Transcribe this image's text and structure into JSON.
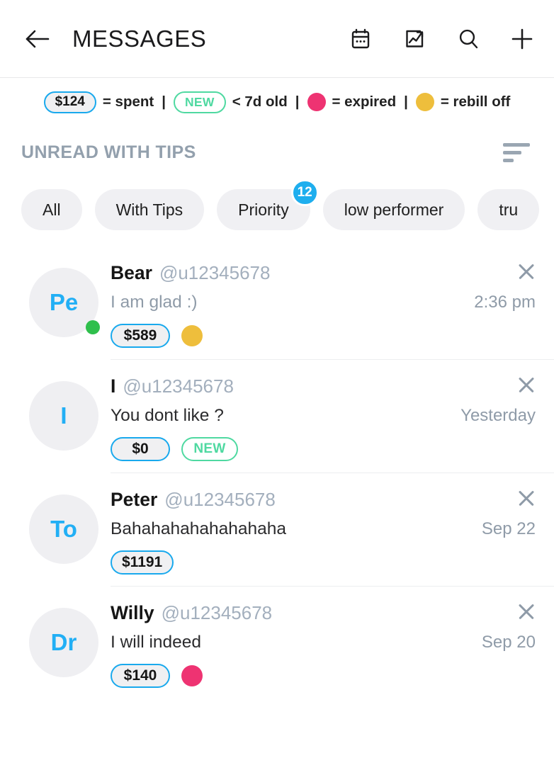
{
  "header": {
    "title": "MESSAGES",
    "back_icon": "arrow-left-icon",
    "actions": [
      {
        "icon": "calendar-icon",
        "name": "calendar-button"
      },
      {
        "icon": "chart-image-icon",
        "name": "stats-button"
      },
      {
        "icon": "search-icon",
        "name": "search-button"
      },
      {
        "icon": "plus-icon",
        "name": "new-message-button"
      }
    ]
  },
  "legend": {
    "spent_pill": "$124",
    "spent_label": "= spent",
    "sep1": "|",
    "new_pill": "NEW",
    "new_label": "< 7d old",
    "sep2": "|",
    "expired_label": "= expired",
    "sep3": "|",
    "rebill_label": "= rebill off",
    "expired_color": "#ee3372",
    "rebill_color": "#eebe3c",
    "pill_border_color": "#19a9ed",
    "new_color": "#4fd9a1"
  },
  "section": {
    "title": "UNREAD WITH TIPS",
    "sort_icon": "sort-descending-icon"
  },
  "chips": [
    {
      "label": "All",
      "badge": null
    },
    {
      "label": "With Tips",
      "badge": null
    },
    {
      "label": "Priority",
      "badge": "12"
    },
    {
      "label": "low performer",
      "badge": null
    },
    {
      "label": "tru",
      "badge": null
    }
  ],
  "conversations": [
    {
      "avatar_initials": "Pe",
      "online": true,
      "name": "Bear",
      "handle": "@u12345678",
      "preview": "I am glad :)",
      "preview_read": true,
      "time": "2:36 pm",
      "amount": "$589",
      "is_new": false,
      "status_dot": "#eebe3c"
    },
    {
      "avatar_initials": "I",
      "online": false,
      "name": "I",
      "handle": "@u12345678",
      "preview": "You dont like ?",
      "preview_read": false,
      "time": "Yesterday",
      "amount": "$0",
      "is_new": true,
      "new_label": "NEW",
      "status_dot": null
    },
    {
      "avatar_initials": "To",
      "online": false,
      "name": "Peter",
      "handle": "@u12345678",
      "preview": "Bahahahahahahahaha",
      "preview_read": false,
      "time": "Sep 22",
      "amount": "$1191",
      "is_new": false,
      "status_dot": null
    },
    {
      "avatar_initials": "Dr",
      "online": false,
      "name": "Willy",
      "handle": "@u12345678",
      "preview": "I will indeed",
      "preview_read": false,
      "time": "Sep 20",
      "amount": "$140",
      "is_new": false,
      "status_dot": "#ee3372"
    }
  ]
}
